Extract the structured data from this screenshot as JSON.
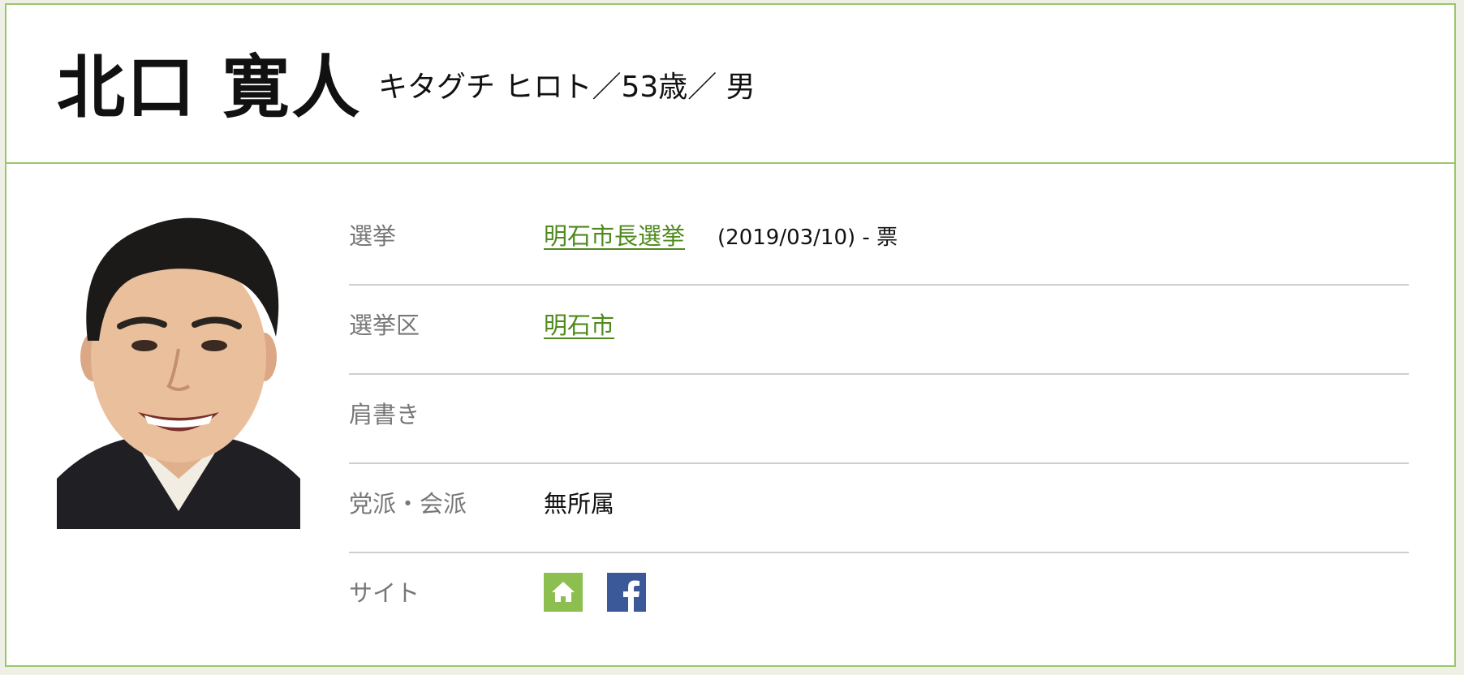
{
  "candidate": {
    "name": "北口 寛人",
    "sub_info": "キタグチ ヒロト／53歳／ 男"
  },
  "details": {
    "election": {
      "label": "選挙",
      "link_text": "明石市長選挙",
      "date_votes": "(2019/03/10) - 票"
    },
    "district": {
      "label": "選挙区",
      "link_text": "明石市"
    },
    "title": {
      "label": "肩書き",
      "value": ""
    },
    "party": {
      "label": "党派・会派",
      "value": "無所属"
    },
    "site": {
      "label": "サイト",
      "icons": [
        "home-icon",
        "facebook-icon"
      ]
    }
  },
  "colors": {
    "border_green": "#9cc56a",
    "link_green": "#4f8a1c",
    "home_icon_bg": "#8cbf4f",
    "facebook_bg": "#3b5998"
  }
}
